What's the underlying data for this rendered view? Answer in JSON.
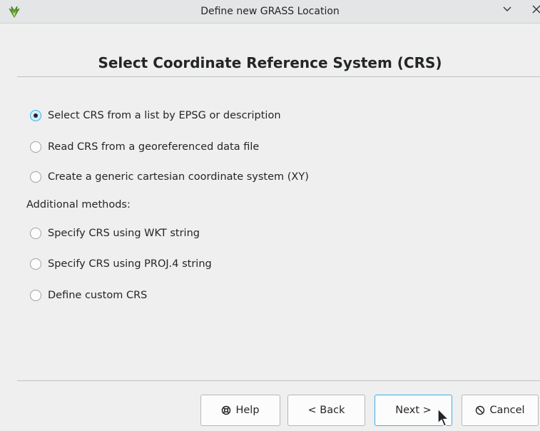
{
  "window": {
    "title": "Define new GRASS Location",
    "icon": "grass-logo-icon",
    "controls": {
      "minimize": "⌵",
      "close": "✕"
    }
  },
  "page": {
    "heading": "Select Coordinate Reference System (CRS)"
  },
  "options": [
    {
      "label": "Select CRS from a list by EPSG or description",
      "checked": true
    },
    {
      "label": "Read CRS from a georeferenced data file",
      "checked": false
    },
    {
      "label": "Create a generic cartesian coordinate system (XY)",
      "checked": false
    }
  ],
  "additional": {
    "label": "Additional methods:",
    "options": [
      {
        "label": "Specify CRS using WKT string",
        "checked": false
      },
      {
        "label": "Specify CRS using PROJ.4 string",
        "checked": false
      },
      {
        "label": "Define custom CRS",
        "checked": false
      }
    ]
  },
  "buttons": {
    "help": "Help",
    "back": "< Back",
    "next": "Next >",
    "cancel": "Cancel"
  },
  "colors": {
    "accent": "#3daee9",
    "grass_green": "#5a9e32"
  }
}
